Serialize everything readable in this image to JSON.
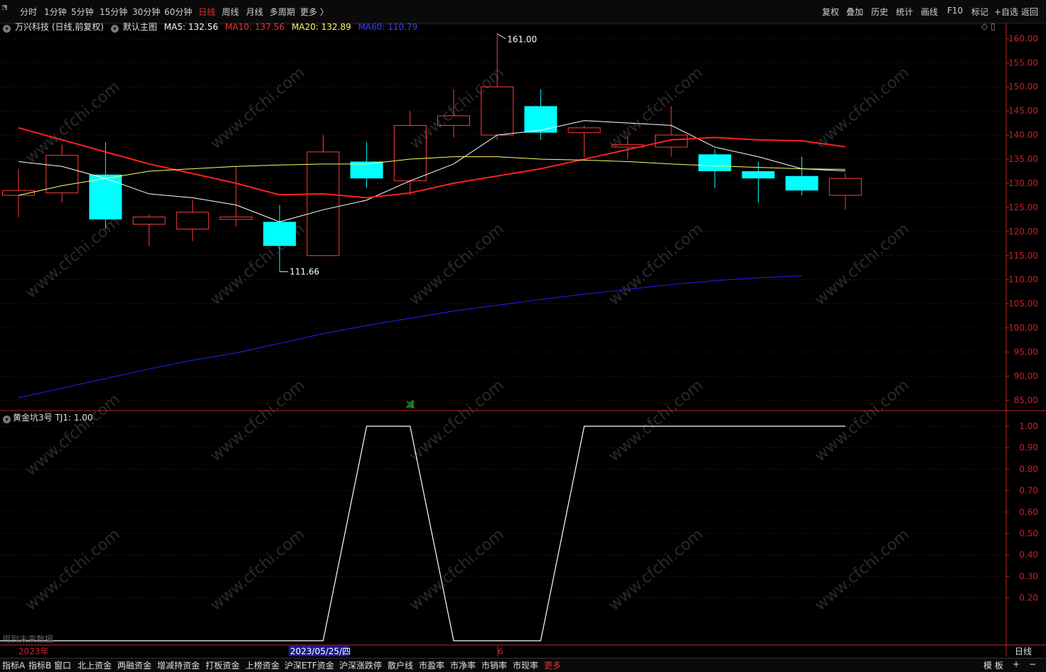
{
  "toolbar": {
    "periods": [
      "分时",
      "1分钟",
      "5分钟",
      "15分钟",
      "30分钟",
      "60分钟",
      "日线",
      "周线",
      "月线",
      "多周期",
      "更多 〉"
    ],
    "active_period": "日线",
    "right_buttons": [
      "复权",
      "叠加",
      "历史",
      "统计",
      "画线",
      "F10",
      "标记",
      "+自选",
      "返回"
    ]
  },
  "legend": {
    "stock": "万兴科技 (日线,前复权)",
    "template": "默认主图",
    "ma5": "MA5: 132.56",
    "ma10": "MA10: 137.56",
    "ma20": "MA20: 132.89",
    "ma60": "MA60: 110.79"
  },
  "indicator": {
    "name": "黄金坑3号",
    "value": "TJ1: 1.00"
  },
  "annotations": {
    "high": "161.00",
    "low": "111.66",
    "signal": "减",
    "future_note": "用到未来数据"
  },
  "time_axis": {
    "year": "2023年",
    "cursor_date": "2023/05/25/四",
    "month": "6",
    "period_label": "日线"
  },
  "bottom_tabs": [
    "指标A",
    "指标B",
    "窗口",
    "北上资金",
    "两融资金",
    "增减持资金",
    "打板资金",
    "上榜资金",
    "沪深ETF资金",
    "沪深涨跌停",
    "散户线",
    "市盈率",
    "市净率",
    "市销率",
    "市现率",
    "更多"
  ],
  "bottom_right": [
    "模 板",
    "+",
    "−"
  ],
  "watermark": "www.cfchi.com",
  "colors": {
    "up": "#ff3b3b",
    "down": "#00ffff",
    "ma5": "#ffffff",
    "ma10": "#ff2020",
    "ma20": "#ffff66",
    "ma60": "#2020ff",
    "axis": "#c0242b"
  },
  "chart_data": [
    {
      "type": "candlestick",
      "y_ticks": [
        160,
        155,
        150,
        145,
        140,
        135,
        130,
        125,
        120,
        115,
        110,
        105,
        100,
        95,
        90,
        85
      ],
      "ylim": [
        83,
        163
      ],
      "candles": [
        {
          "open": 127.5,
          "close": 128.5,
          "high": 133,
          "low": 123
        },
        {
          "open": 128,
          "close": 135.8,
          "high": 138,
          "low": 126
        },
        {
          "open": 131.8,
          "close": 122.5,
          "high": 138.5,
          "low": 120.5
        },
        {
          "open": 121.5,
          "close": 123,
          "high": 123.5,
          "low": 117
        },
        {
          "open": 120.5,
          "close": 124,
          "high": 126.5,
          "low": 118
        },
        {
          "open": 122.5,
          "close": 123,
          "high": 133.5,
          "low": 121
        },
        {
          "open": 122,
          "close": 117,
          "high": 125.5,
          "low": 111.66
        },
        {
          "open": 115,
          "close": 136.5,
          "high": 140,
          "low": 115
        },
        {
          "open": 134.5,
          "close": 131,
          "high": 138.5,
          "low": 129
        },
        {
          "open": 130.5,
          "close": 142,
          "high": 145,
          "low": 127.5
        },
        {
          "open": 142,
          "close": 144,
          "high": 149.5,
          "low": 139.5
        },
        {
          "open": 140,
          "close": 150,
          "high": 161,
          "low": 139
        },
        {
          "open": 146,
          "close": 140.5,
          "high": 149.5,
          "low": 139
        },
        {
          "open": 140.5,
          "close": 141.5,
          "high": 142,
          "low": 135.5
        },
        {
          "open": 137.5,
          "close": 138,
          "high": 140,
          "low": 135
        },
        {
          "open": 137.5,
          "close": 140,
          "high": 146,
          "low": 135.5
        },
        {
          "open": 136,
          "close": 132.5,
          "high": 137,
          "low": 129
        },
        {
          "open": 132.5,
          "close": 131,
          "high": 134.5,
          "low": 126
        },
        {
          "open": 131.5,
          "close": 128.5,
          "high": 135.5,
          "low": 127.5
        },
        {
          "open": 127.5,
          "close": 131,
          "high": 132,
          "low": 124.5
        }
      ],
      "series": [
        {
          "name": "MA5",
          "values": [
            134.5,
            133.5,
            131,
            127.8,
            127,
            125.5,
            122,
            124.5,
            126.5,
            130.5,
            134,
            140,
            141,
            143,
            142.5,
            142,
            137.5,
            135.5,
            133,
            132.56
          ]
        },
        {
          "name": "MA10",
          "values": [
            141.5,
            139,
            136.5,
            134,
            132,
            130,
            127.6,
            127.8,
            127,
            128,
            130,
            131.5,
            133,
            135,
            137,
            139,
            139.5,
            139,
            138.8,
            137.56
          ]
        },
        {
          "name": "MA20",
          "values": [
            127.5,
            129.5,
            131,
            132.5,
            133,
            133.5,
            133.8,
            134,
            134,
            135,
            135.5,
            135.5,
            135,
            134.8,
            134.5,
            134,
            133.6,
            133.3,
            133,
            132.89
          ]
        },
        {
          "name": "MA60",
          "values": [
            85.5,
            87.5,
            89.5,
            91.5,
            93.3,
            94.8,
            96.8,
            98.8,
            100.5,
            102,
            103.5,
            104.7,
            105.9,
            107,
            108,
            109,
            109.8,
            110.4,
            110.79
          ]
        }
      ]
    },
    {
      "type": "line",
      "name": "TJ1",
      "y_ticks": [
        1.0,
        0.9,
        0.8,
        0.7,
        0.6,
        0.5,
        0.4,
        0.3,
        0.2
      ],
      "ylim": [
        0,
        1.0
      ],
      "values": [
        0,
        0,
        0,
        0,
        0,
        0,
        0,
        0,
        1,
        1,
        0,
        0,
        0,
        1,
        1,
        1,
        1,
        1,
        1,
        1
      ]
    }
  ]
}
